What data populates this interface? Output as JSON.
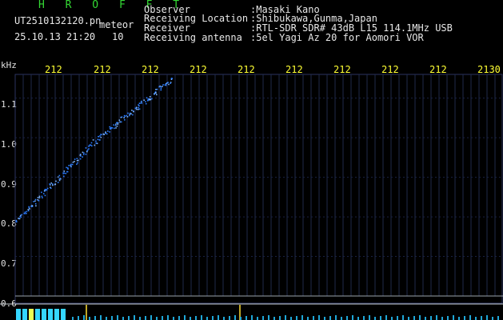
{
  "app": {
    "name": "H R O F F T"
  },
  "file": {
    "name": "UT2510132120.pn",
    "type": "meteor",
    "datetime": "25.10.13 21:20",
    "count": "10"
  },
  "info": {
    "observer_label": "Observer",
    "observer_value": ":Masaki Kano",
    "location_label": "Receiving Location",
    "location_value": ":Shibukawa,Gunma,Japan",
    "receiver_label": "Receiver",
    "receiver_value": ":RTL-SDR SDR# 43dB L15 114.1MHz USB",
    "antenna_label": "Receiving antenna",
    "antenna_value": ":5el Yagi Az 20 for Aomori VOR"
  },
  "axis": {
    "unit": "kHz",
    "top_ticks": [
      "212",
      "212",
      "212",
      "212",
      "212",
      "212",
      "212",
      "212",
      "212",
      "2130"
    ],
    "y_ticks": [
      "1.1",
      "1.0",
      "0.9",
      "0.8",
      "0.7",
      "0.6"
    ]
  },
  "chart_data": {
    "type": "scatter",
    "title": "",
    "xlabel": "",
    "ylabel": "kHz",
    "ylim": [
      0.6,
      1.16
    ],
    "series": [
      {
        "values": [
          [
            0.0,
            0.79
          ],
          [
            1.5,
            0.84
          ],
          [
            3.0,
            0.89
          ],
          [
            4.5,
            0.94
          ],
          [
            6.0,
            0.99
          ],
          [
            7.5,
            1.03
          ],
          [
            9.0,
            1.07
          ],
          [
            10.5,
            1.11
          ],
          [
            12.0,
            1.15
          ]
        ]
      }
    ],
    "colors": {
      "streak": "#2a7bff",
      "background": "#000000",
      "grid": "#1f2a4a"
    }
  }
}
